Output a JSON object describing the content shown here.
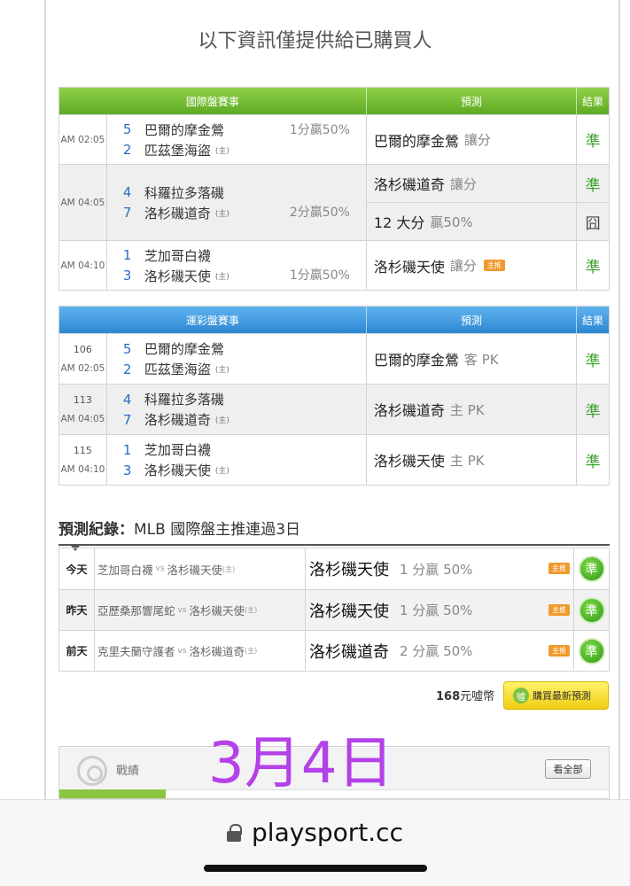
{
  "notice": "以下資訊僅提供給已購買人",
  "intl_table": {
    "headers": [
      "國際盤賽事",
      "預測",
      "結果"
    ],
    "rows": [
      {
        "time": "AM 02:05",
        "away_no": "5",
        "away": "巴爾的摩金鶯",
        "home_no": "2",
        "home": "匹茲堡海盜",
        "home_tag": "(主)",
        "handicap": "1分贏50%",
        "handicap_row": "away",
        "preds": [
          {
            "team": "巴爾的摩金鶯",
            "sub": "讓分",
            "result": "準",
            "badge": ""
          }
        ]
      },
      {
        "time": "AM 04:05",
        "away_no": "4",
        "away": "科羅拉多落磯",
        "home_no": "7",
        "home": "洛杉磯道奇",
        "home_tag": "(主)",
        "handicap": "2分贏50%",
        "handicap_row": "home",
        "preds": [
          {
            "team": "洛杉磯道奇",
            "sub": "讓分",
            "result": "準",
            "badge": ""
          },
          {
            "team": "12 大分",
            "sub": "贏50%",
            "result": "囧",
            "badge": ""
          }
        ]
      },
      {
        "time": "AM 04:10",
        "away_no": "1",
        "away": "芝加哥白襪",
        "home_no": "3",
        "home": "洛杉磯天使",
        "home_tag": "(主)",
        "handicap": "1分贏50%",
        "handicap_row": "home",
        "preds": [
          {
            "team": "洛杉磯天使",
            "sub": "讓分",
            "result": "準",
            "badge": "主推"
          }
        ]
      }
    ]
  },
  "lottery_table": {
    "headers": [
      "運彩盤賽事",
      "預測",
      "結果"
    ],
    "rows": [
      {
        "num": "106",
        "time": "AM 02:05",
        "away_no": "5",
        "away": "巴爾的摩金鶯",
        "home_no": "2",
        "home": "匹茲堡海盜",
        "home_tag": "(主)",
        "pred_team": "巴爾的摩金鶯",
        "pred_sub": "客 PK",
        "result": "準"
      },
      {
        "num": "113",
        "time": "AM 04:05",
        "away_no": "4",
        "away": "科羅拉多落磯",
        "home_no": "7",
        "home": "洛杉磯道奇",
        "home_tag": "(主)",
        "pred_team": "洛杉磯道奇",
        "pred_sub": "主 PK",
        "result": "準"
      },
      {
        "num": "115",
        "time": "AM 04:10",
        "away_no": "1",
        "away": "芝加哥白襪",
        "home_no": "3",
        "home": "洛杉磯天使",
        "home_tag": "(主)",
        "pred_team": "洛杉磯天使",
        "pred_sub": "主 PK",
        "result": "準"
      }
    ]
  },
  "record": {
    "title_bold": "預測紀錄：",
    "title_rest": "MLB 國際盤主推連過3日",
    "rows": [
      {
        "day": "今天",
        "away": "芝加哥白襪",
        "vs": "vs",
        "home": "洛杉磯天使",
        "home_tag": "(主)",
        "pick": "洛杉磯天使",
        "odds": "1 分贏 50%",
        "badge": "主推",
        "result": "準"
      },
      {
        "day": "昨天",
        "away": "亞歷桑那響尾蛇",
        "vs": "vs",
        "home": "洛杉磯天使",
        "home_tag": "(主)",
        "pick": "洛杉磯天使",
        "odds": "1 分贏 50%",
        "badge": "主推",
        "result": "準"
      },
      {
        "day": "前天",
        "away": "克里夫蘭守護者",
        "vs": "vs",
        "home": "洛杉磯道奇",
        "home_tag": "(主)",
        "pick": "洛杉磯道奇",
        "odds": "2 分贏 50%",
        "badge": "主推",
        "result": "準"
      }
    ]
  },
  "purchase": {
    "price_num": "168",
    "price_unit": "元噓幣",
    "button_label": "購買最新預測",
    "button_icon": "噓"
  },
  "overlay_date": "3月4日",
  "stats": {
    "label": "戰績",
    "see_all": "看全部"
  },
  "browser": {
    "url": "playsport.cc"
  },
  "colors": {
    "intl_header": "#5daa22",
    "lottery_header": "#2c88d4",
    "hit": "#3aa02a",
    "badge": "#f09a2c",
    "overlay": "#b541e8"
  }
}
